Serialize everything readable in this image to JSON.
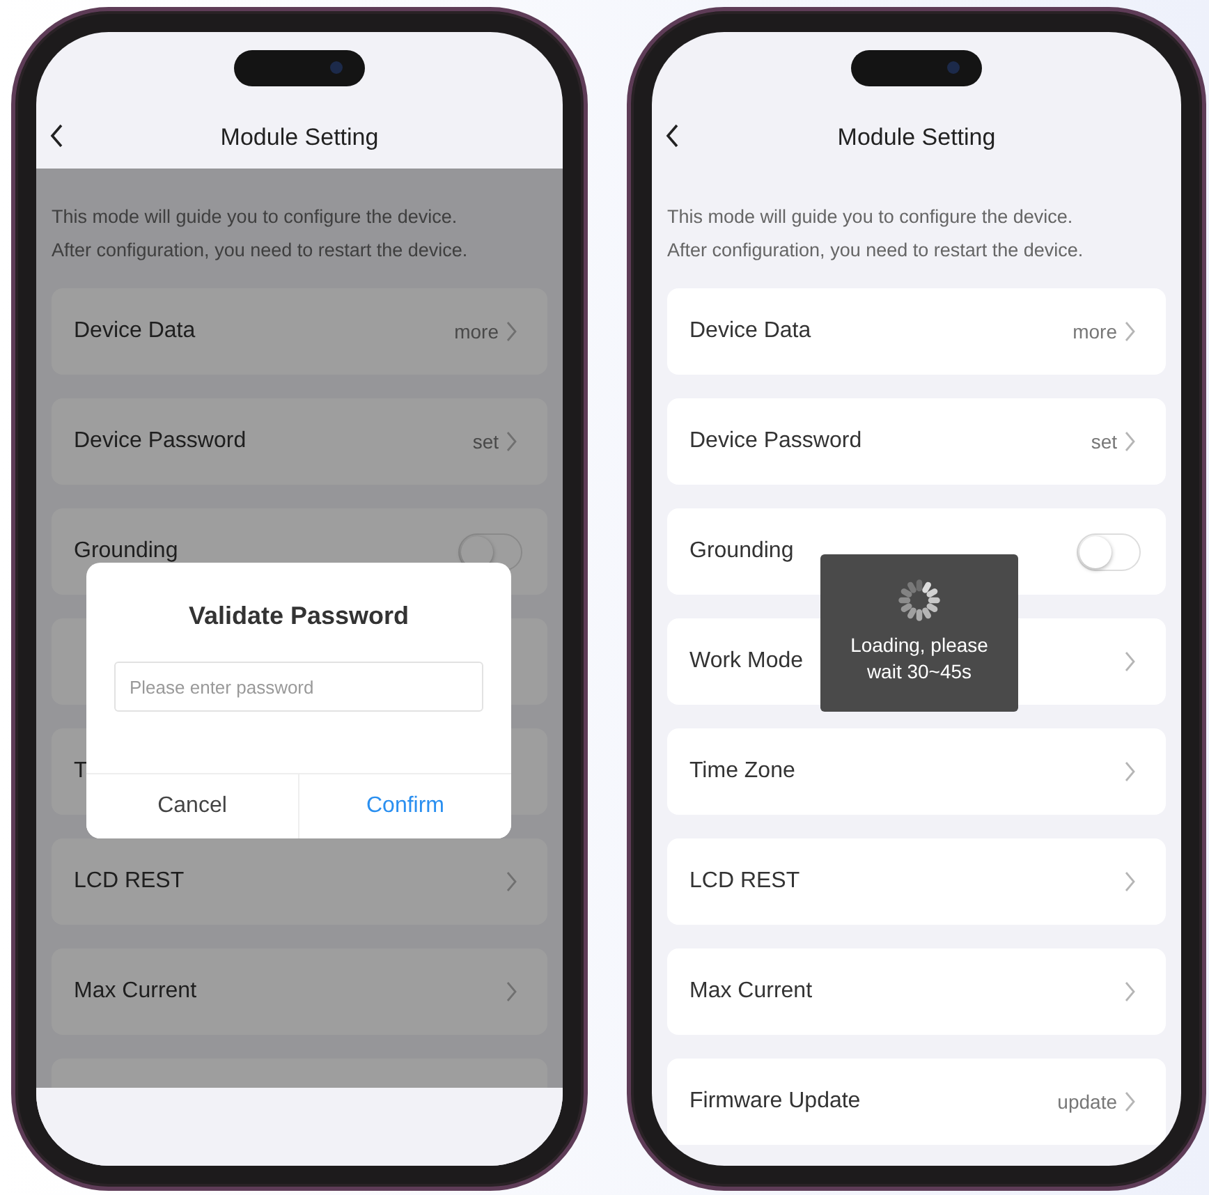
{
  "screens": [
    {
      "title": "Module Setting",
      "dimmed": true,
      "description": [
        "This mode will guide you to configure the device.",
        "After configuration, you need to restart the device."
      ],
      "items": [
        {
          "kind": "link",
          "label": "Device Data",
          "value": "more"
        },
        {
          "kind": "link",
          "label": "Device Password",
          "value": "set"
        },
        {
          "kind": "toggle",
          "label": "Grounding",
          "on": false
        },
        {
          "kind": "empty"
        },
        {
          "kind": "plain",
          "label": "T"
        },
        {
          "kind": "link",
          "label": "LCD REST"
        },
        {
          "kind": "link",
          "label": "Max Current"
        },
        {
          "kind": "empty"
        }
      ],
      "dialog": {
        "title": "Validate Password",
        "field": {
          "placeholder": "Please enter password"
        },
        "buttons": [
          {
            "label": "Cancel",
            "primary": false
          },
          {
            "label": "Confirm",
            "primary": true
          }
        ]
      }
    },
    {
      "title": "Module Setting",
      "dimmed": false,
      "description": [
        "This mode will guide you to configure the device.",
        "After configuration, you need to restart the device."
      ],
      "items": [
        {
          "kind": "link",
          "label": "Device Data",
          "value": "more"
        },
        {
          "kind": "link",
          "label": "Device Password",
          "value": "set"
        },
        {
          "kind": "toggle",
          "label": "Grounding",
          "on": false
        },
        {
          "kind": "link",
          "label": "Work Mode"
        },
        {
          "kind": "link",
          "label": "Time Zone"
        },
        {
          "kind": "link",
          "label": "LCD REST"
        },
        {
          "kind": "link",
          "label": "Max Current"
        },
        {
          "kind": "link",
          "label": "Firmware Update",
          "value": "update"
        }
      ],
      "toast": {
        "message": "Loading, please wait 30~45s"
      }
    }
  ]
}
